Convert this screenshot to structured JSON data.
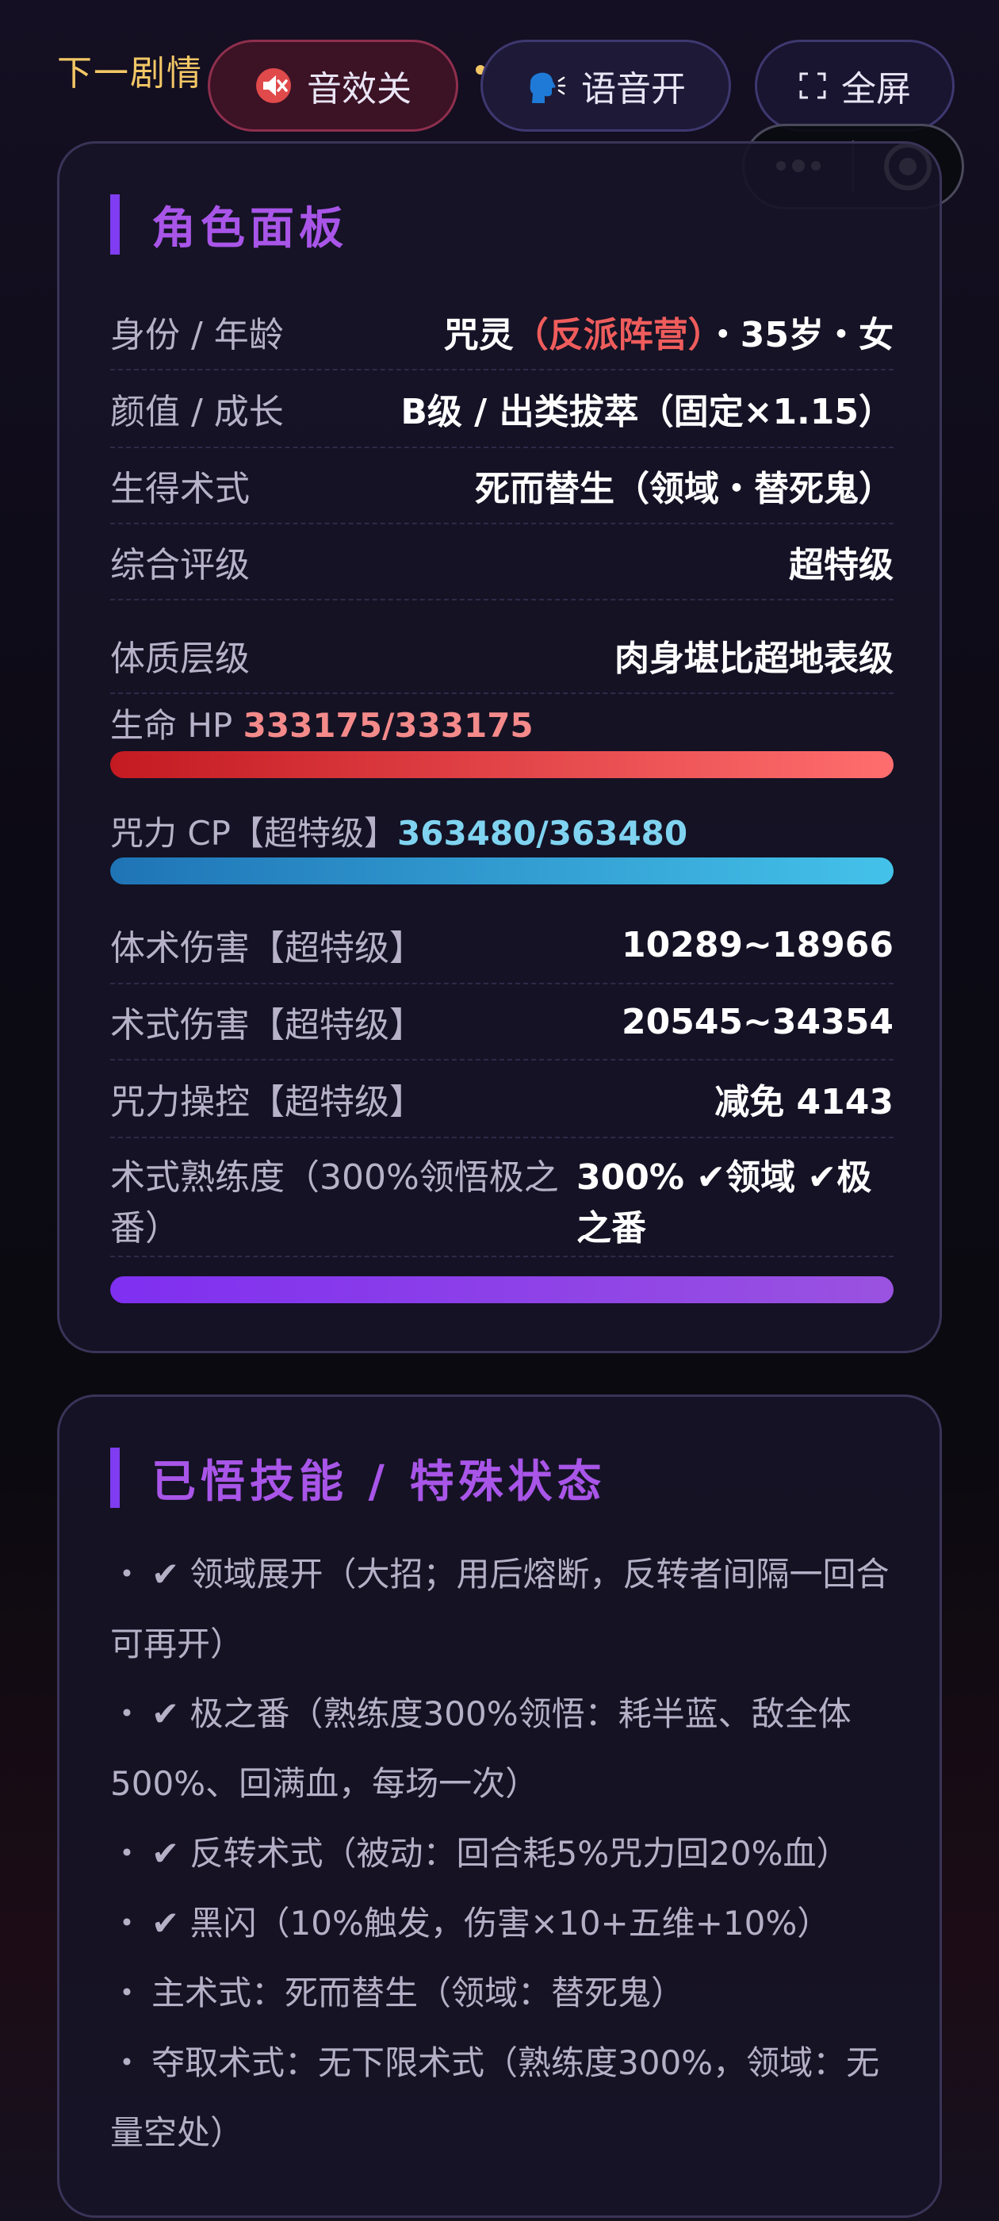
{
  "topbar": {
    "next_plot": "下一剧情",
    "sound": {
      "icon": "muted-speaker-icon",
      "label": "音效关"
    },
    "voice": {
      "icon": "speaking-head-icon",
      "label": "语音开"
    },
    "fullscreen": {
      "icon": "fullscreen-corners-icon",
      "label": "全屏"
    }
  },
  "mini_program": {
    "more_icon": "more-dots-icon",
    "close_icon": "target-circle-icon"
  },
  "role_panel": {
    "title": "角色面板",
    "identity": {
      "label": "身份 / 年龄",
      "v1": "咒灵",
      "v2": "（反派阵营）",
      "v3": "・35岁・女"
    },
    "looks": {
      "label": "颜值 / 成长",
      "value": "B级 / 出类拔萃（固定×1.15）"
    },
    "innate": {
      "label": "生得术式",
      "value": "死而替生（领域・替死鬼）"
    },
    "rating": {
      "label": "综合评级",
      "value": "超特级"
    },
    "physique": {
      "label": "体质层级",
      "value": "肉身堪比超地表级"
    },
    "hp": {
      "label": "生命 HP ",
      "value": "333175/333175",
      "fraction": 1.0
    },
    "cp": {
      "label": "咒力 CP【超特级】",
      "value": "363480/363480",
      "fraction": 1.0
    },
    "melee": {
      "label": "体术伤害【超特级】",
      "value": "10289~18966"
    },
    "technique_dmg": {
      "label": "术式伤害【超特级】",
      "value": "20545~34354"
    },
    "control": {
      "label": "咒力操控【超特级】",
      "value": "减免 4143"
    },
    "mastery": {
      "label": "术式熟练度（300%领悟极之番）",
      "value": "300% ✔领域 ✔极之番",
      "fraction": 1.0
    }
  },
  "skills_panel": {
    "title": "已悟技能 / 特殊状态",
    "items": [
      "✔ 领域展开（大招；用后熔断，反转者间隔一回合可再开）",
      "✔ 极之番（熟练度300%领悟：耗半蓝、敌全体500%、回满血，每场一次）",
      "✔ 反转术式（被动：回合耗5%咒力回20%血）",
      "✔ 黑闪（10%触发，伤害×10+五维+10%）",
      "主术式：死而替生（领域：替死鬼）",
      "夺取术式：无下限术式（熟练度300%，领域：无量空处）"
    ]
  }
}
